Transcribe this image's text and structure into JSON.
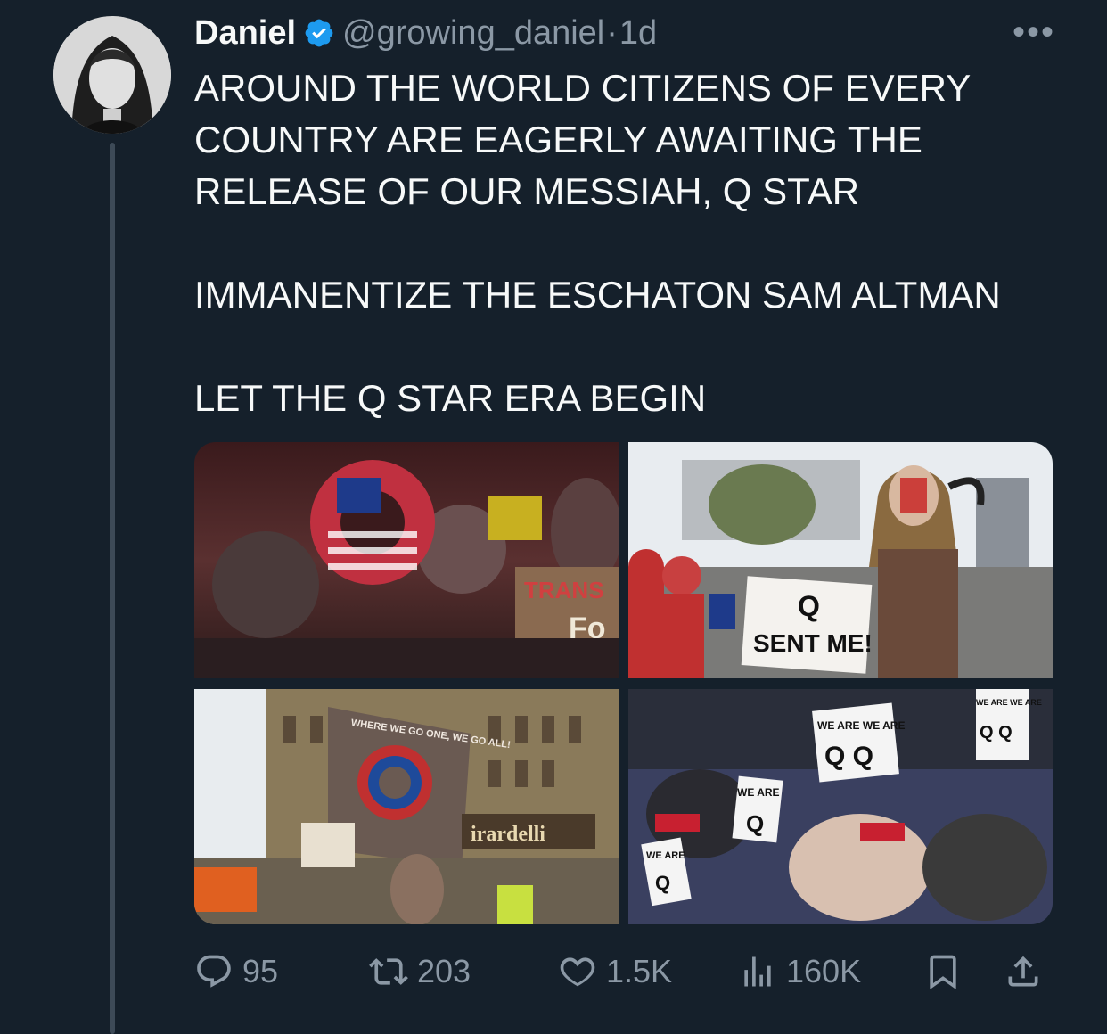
{
  "tweet": {
    "author_name": "Daniel",
    "handle": "@growing_daniel",
    "separator": "·",
    "time": "1d",
    "more_label": "•••",
    "paragraphs": [
      "AROUND THE WORLD CITIZENS OF EVERY COUNTRY ARE EAGERLY AWAITING THE RELEASE OF OUR MESSIAH, Q STAR",
      "IMMANENTIZE THE ESCHATON SAM ALTMAN",
      "LET THE Q STAR ERA BEGIN"
    ],
    "media_text": {
      "img1_sign": "TRANS",
      "img1_sign2": "Fo",
      "img2_sign_q": "Q",
      "img2_sign_text": "SENT ME!",
      "img3_flag_top": "WHERE WE GO ONE, WE GO ALL!",
      "img3_store": "irardelli",
      "img4_sign1": "WE ARE WE ARE",
      "img4_sign1_q": "Q Q",
      "img4_sign2": "WE ARE",
      "img4_sign2_q": "Q",
      "img4_sign3": "WE ARE",
      "img4_sign3_q": "Q",
      "img4_sign4": "WE ARE WE ARE",
      "img4_sign4_q": "Q Q"
    },
    "stats": {
      "replies": "95",
      "retweets": "203",
      "likes": "1.5K",
      "views": "160K"
    }
  },
  "colors": {
    "background": "#15202b",
    "text": "#f7f9f9",
    "secondary": "#8b98a5",
    "verified": "#1d9bf0"
  }
}
